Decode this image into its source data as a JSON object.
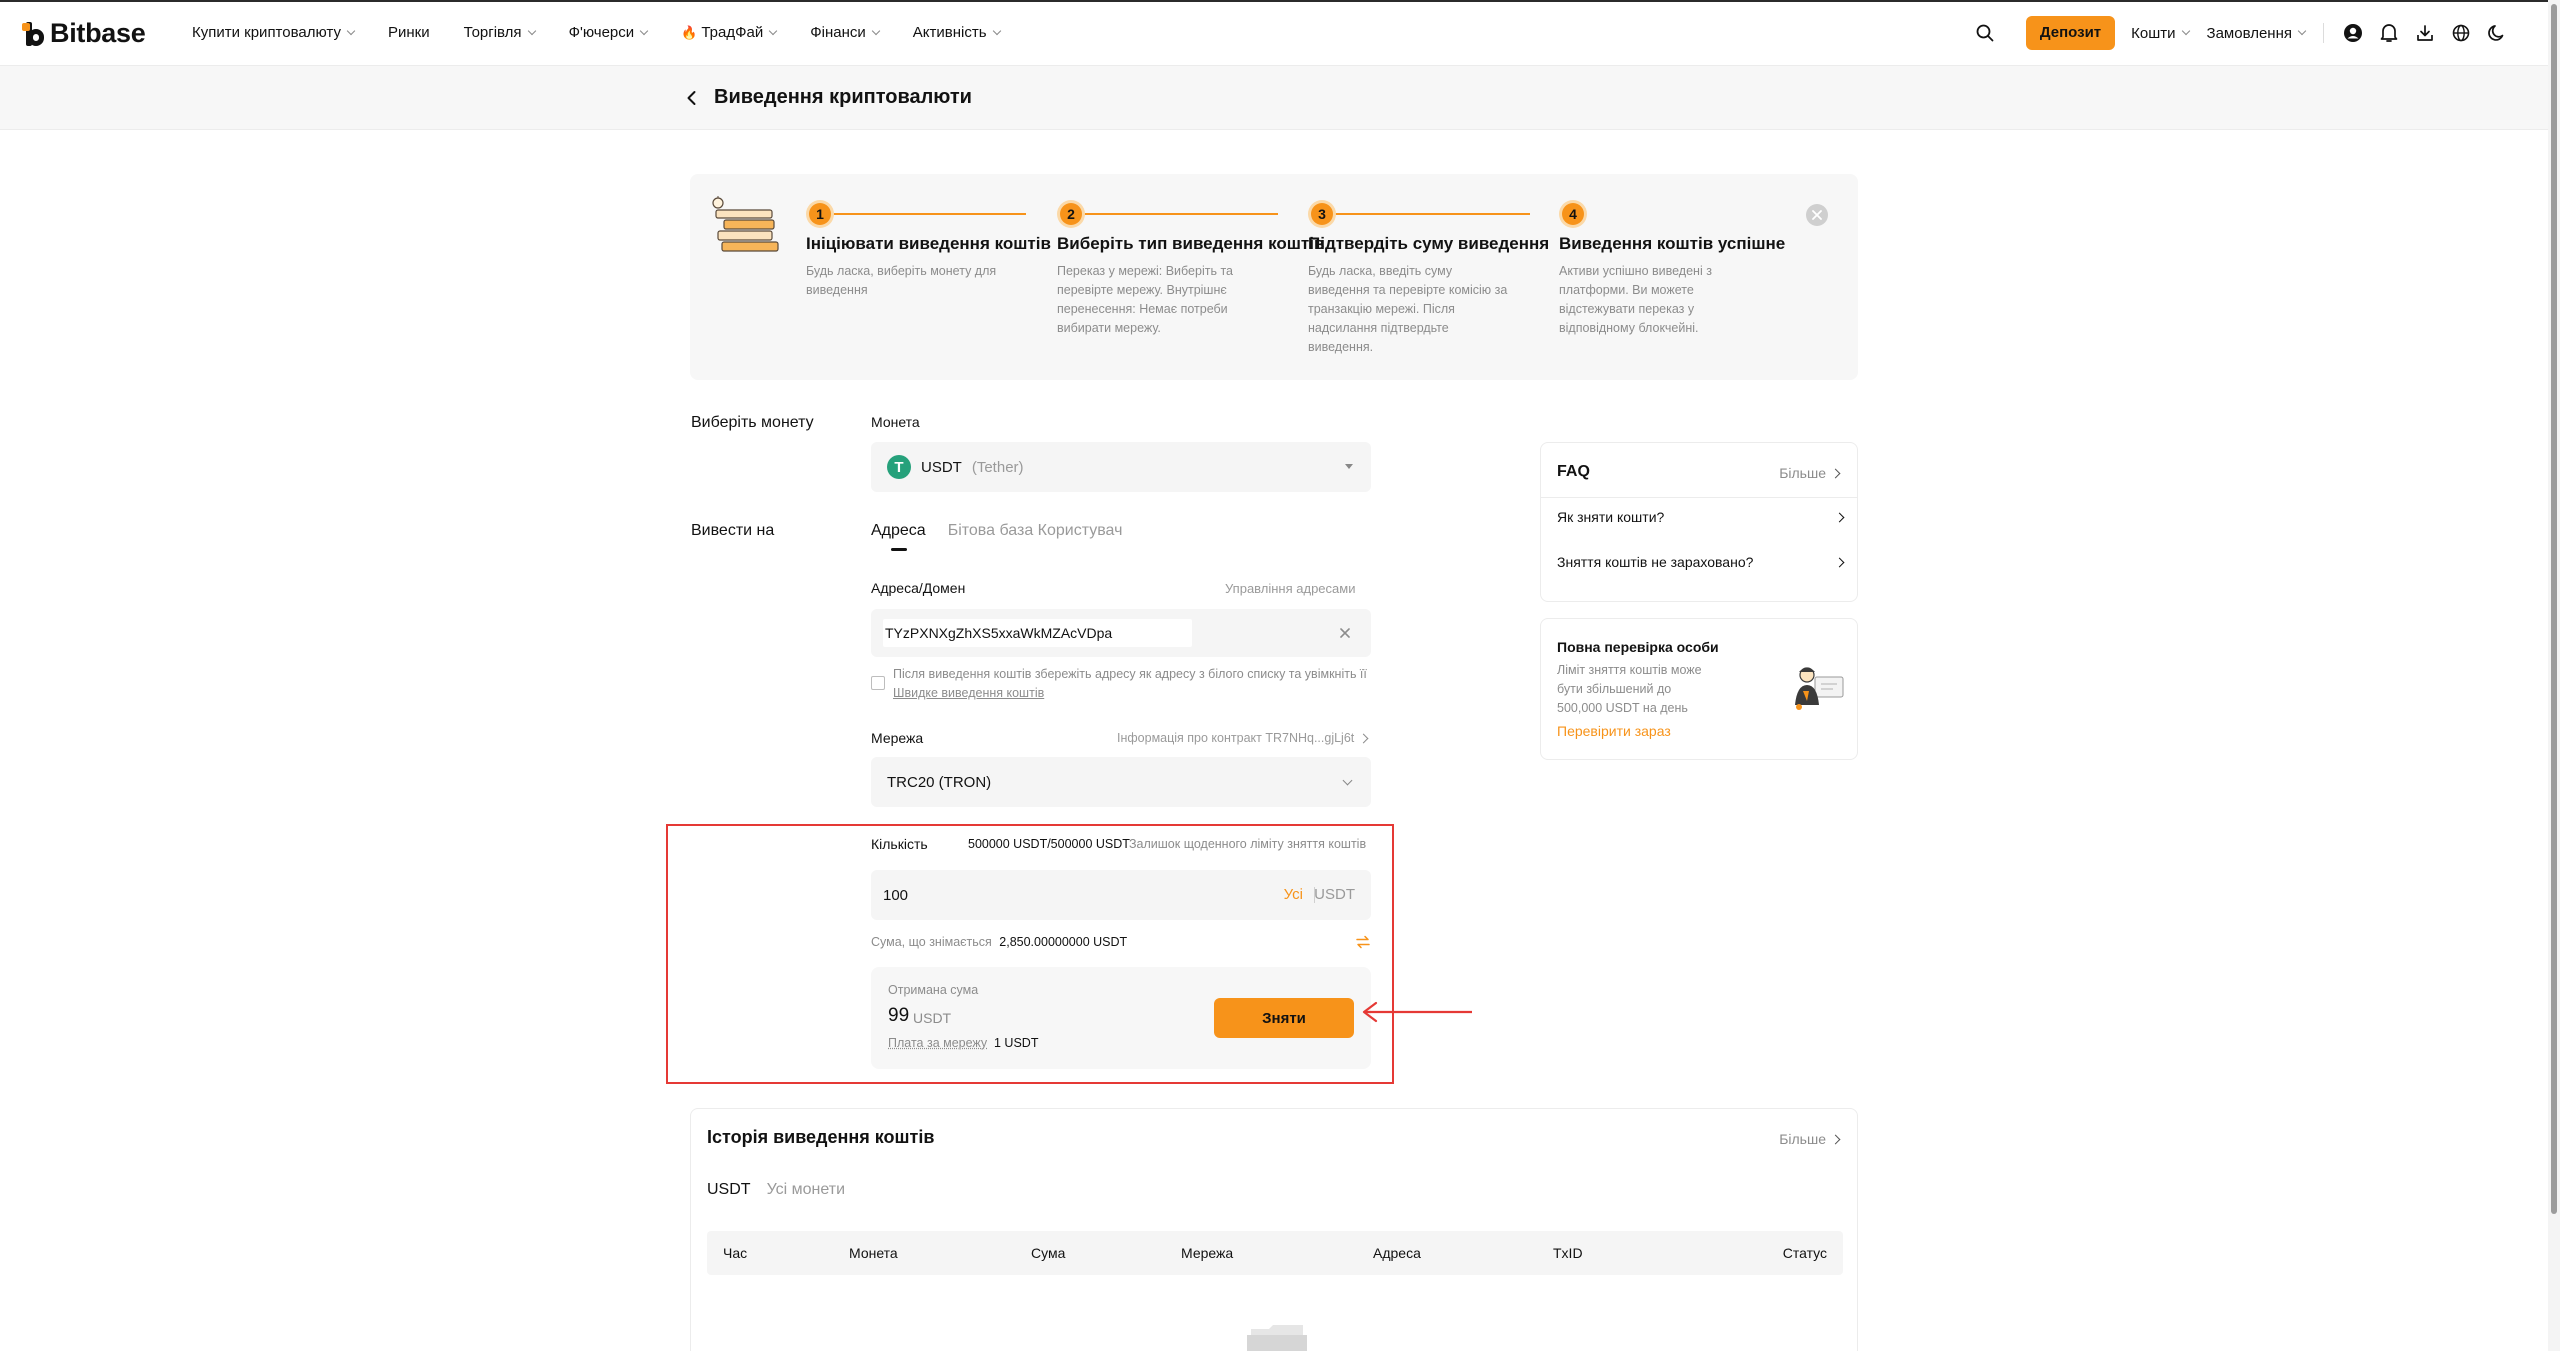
{
  "nav": {
    "logo": "Bitbase",
    "items": [
      {
        "label": "Купити криптовалюту",
        "dropdown": true
      },
      {
        "label": "Ринки",
        "dropdown": false
      },
      {
        "label": "Торгівля",
        "dropdown": true
      },
      {
        "label": "Ф'ючерси",
        "dropdown": true
      },
      {
        "label": "ТрадФай",
        "dropdown": true,
        "hot": true
      },
      {
        "label": "Фінанси",
        "dropdown": true
      },
      {
        "label": "Активність",
        "dropdown": true
      }
    ],
    "deposit_label": "Депозит",
    "funds_label": "Кошти",
    "orders_label": "Замовлення"
  },
  "page": {
    "title": "Виведення криптовалюти"
  },
  "steps": [
    {
      "num": "1",
      "title": "Ініціювати виведення коштів",
      "desc": "Будь ласка, виберіть монету для виведення"
    },
    {
      "num": "2",
      "title": "Виберіть тип виведення коштів",
      "desc": "Переказ у мережі: Виберіть та перевірте мережу. Внутрішнє перенесення: Немає потреби вибирати мережу."
    },
    {
      "num": "3",
      "title": "Підтвердіть суму виведення",
      "desc": "Будь ласка, введіть суму виведення та перевірте комісію за транзакцію мережі. Після надсилання підтвердьте виведення."
    },
    {
      "num": "4",
      "title": "Виведення коштів успішне",
      "desc": "Активи успішно виведені з платформи. Ви можете відстежувати переказ у відповідному блокчейні."
    }
  ],
  "form": {
    "select_coin_label": "Виберіть монету",
    "coin_label": "Монета",
    "coin_symbol": "USDT",
    "coin_name": "(Tether)",
    "withdraw_to_label": "Вивести на",
    "tabs": [
      "Адреса",
      "Бітова база Користувач"
    ],
    "address_label": "Адреса/Домен",
    "manage_addresses": "Управління адресами",
    "address_value": "TYzPXNXgZhXS5xxaWkMZAcVDpa",
    "whitelist_text": "Після виведення коштів збережіть адресу як адресу з білого списку та увімкніть її",
    "whitelist_link": "Швидке виведення коштів",
    "network_label": "Мережа",
    "contract_info": "Інформація про контракт TR7NHq...gjLj6t",
    "network_value": "TRC20 (TRON)",
    "quantity_label": "Кількість",
    "quantity_limit": "500000 USDT/500000 USDT",
    "quantity_limit_desc": "Залишок щоденного ліміту зняття коштів",
    "quantity_value": "100",
    "all_label": "Усі",
    "unit": "USDT",
    "withdrawable_label": "Сума, що знімається",
    "withdrawable_value": "2,850.00000000 USDT",
    "received_label": "Отримана сума",
    "received_value": "99",
    "received_unit": "USDT",
    "fee_label": "Плата за мережу",
    "fee_value": "1 USDT",
    "withdraw_btn": "Зняти"
  },
  "faq": {
    "title": "FAQ",
    "more": "Більше",
    "items": [
      "Як зняти кошти?",
      "Зняття коштів не зараховано?"
    ]
  },
  "verify": {
    "title": "Повна перевірка особи",
    "desc": "Ліміт зняття коштів може бути збільшений до 500,000 USDT на день",
    "link": "Перевірити зараз"
  },
  "history": {
    "title": "Історія виведення коштів",
    "more": "Більше",
    "tabs": [
      "USDT",
      "Усі монети"
    ],
    "columns": [
      "Час",
      "Монета",
      "Сума",
      "Мережа",
      "Адреса",
      "TxID",
      "Статус"
    ]
  },
  "colors": {
    "accent": "#f7931a",
    "highlight_box": "#e53935",
    "tether": "#26a17b"
  }
}
